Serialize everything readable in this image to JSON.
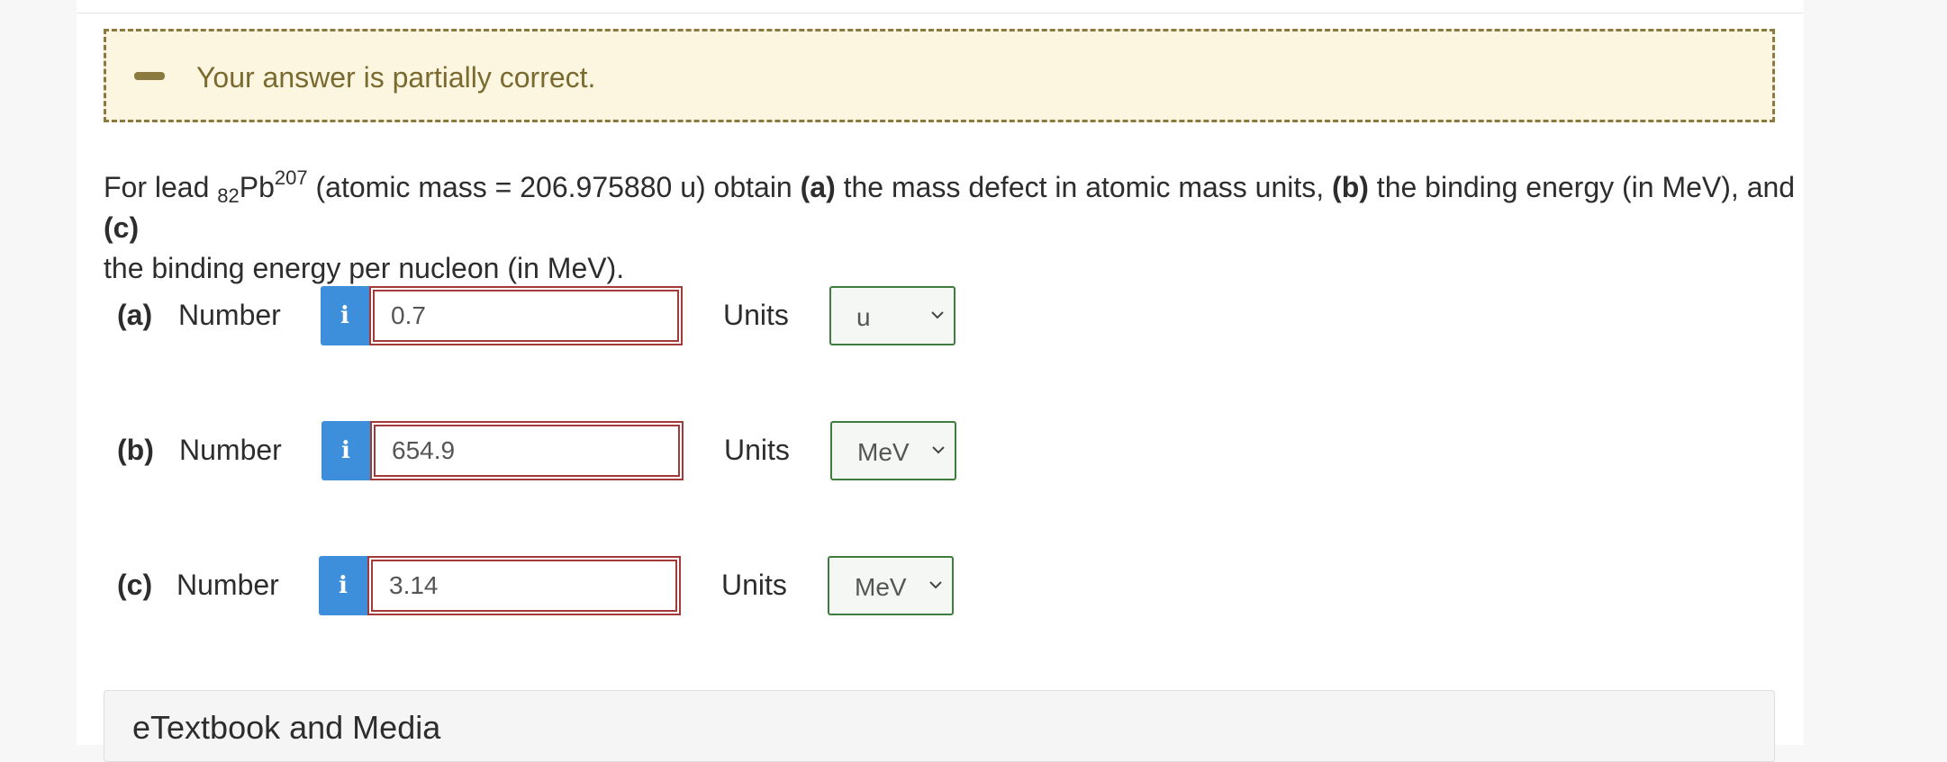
{
  "feedback": {
    "icon": "minus-icon",
    "message": "Your answer is partially correct."
  },
  "question": {
    "t1": "For lead ",
    "sub": "82",
    "element": "Pb",
    "sup": "207",
    "t2": " (atomic mass = 206.975880 u) obtain ",
    "a": "(a)",
    "t3": " the mass defect in atomic mass units, ",
    "b": "(b)",
    "t4": " the binding energy (in MeV), and ",
    "c": "(c)",
    "t5": " the binding energy per nucleon (in MeV)."
  },
  "rows": [
    {
      "part": "(a)",
      "number_label": "Number",
      "info": "i",
      "value": "0.7",
      "units_label": "Units",
      "unit": "u"
    },
    {
      "part": "(b)",
      "number_label": "Number",
      "info": "i",
      "value": "654.9",
      "units_label": "Units",
      "unit": "MeV"
    },
    {
      "part": "(c)",
      "number_label": "Number",
      "info": "i",
      "value": "3.14",
      "units_label": "Units",
      "unit": "MeV"
    }
  ],
  "media": {
    "title": "eTextbook and Media"
  },
  "colors": {
    "feedback_bg": "#fcf6e1",
    "feedback_border": "#8a7a3f",
    "info_blue": "#3d8fdc",
    "error_red": "#a33a3a",
    "units_green": "#3f7d3f"
  }
}
